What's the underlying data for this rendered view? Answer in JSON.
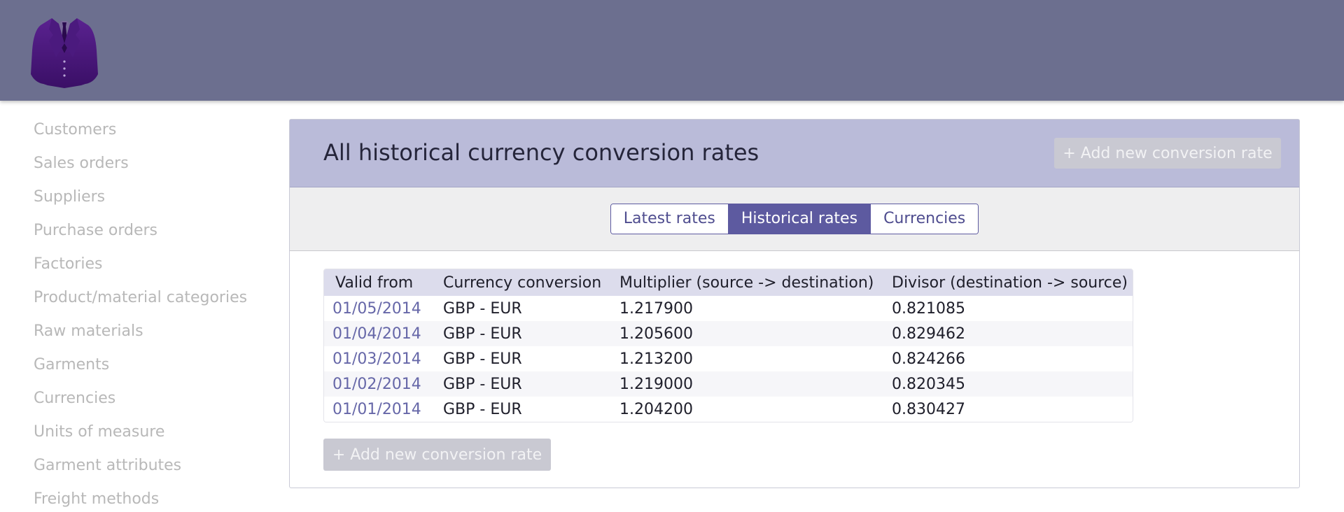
{
  "logo": {
    "icon": "suit-jacket-icon",
    "color": "#4a1a7a"
  },
  "sidebar": {
    "items": [
      {
        "label": "Customers"
      },
      {
        "label": "Sales orders"
      },
      {
        "label": "Suppliers"
      },
      {
        "label": "Purchase orders"
      },
      {
        "label": "Factories"
      },
      {
        "label": "Product/material categories"
      },
      {
        "label": "Raw materials"
      },
      {
        "label": "Garments"
      },
      {
        "label": "Currencies"
      },
      {
        "label": "Units of measure"
      },
      {
        "label": "Garment attributes"
      },
      {
        "label": "Freight methods"
      }
    ]
  },
  "panel": {
    "title": "All historical currency conversion rates",
    "add_button_label": "+ Add new conversion rate",
    "tabs": [
      {
        "label": "Latest rates",
        "active": false
      },
      {
        "label": "Historical rates",
        "active": true
      },
      {
        "label": "Currencies",
        "active": false
      }
    ],
    "table": {
      "columns": [
        "Valid from",
        "Currency conversion",
        "Multiplier (source -> destination)",
        "Divisor (destination -> source)"
      ],
      "rows": [
        [
          "01/05/2014",
          "GBP - EUR",
          "1.217900",
          "0.821085"
        ],
        [
          "01/04/2014",
          "GBP - EUR",
          "1.205600",
          "0.829462"
        ],
        [
          "01/03/2014",
          "GBP - EUR",
          "1.213200",
          "0.824266"
        ],
        [
          "01/02/2014",
          "GBP - EUR",
          "1.219000",
          "0.820345"
        ],
        [
          "01/01/2014",
          "GBP - EUR",
          "1.204200",
          "0.830427"
        ]
      ]
    },
    "footer_button_label": "+ Add new conversion rate"
  },
  "colors": {
    "topbar": "#6c6f8f",
    "panel_header": "#babbd9",
    "accent": "#5d5aa0",
    "link": "#6667a8",
    "disabled_button": "#c9c9d2"
  }
}
